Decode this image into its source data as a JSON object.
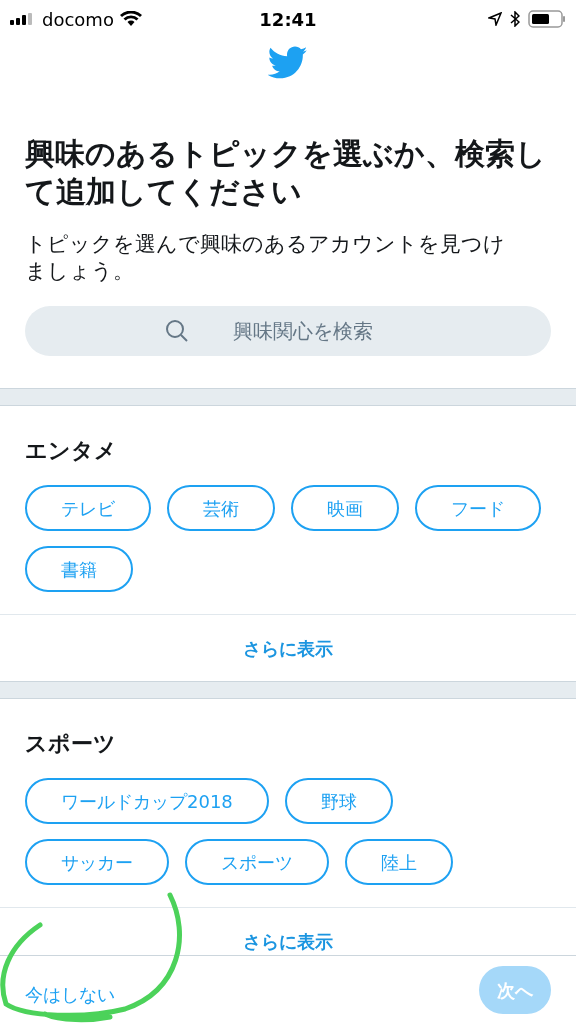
{
  "status_bar": {
    "carrier": "docomo",
    "time": "12:41"
  },
  "title": "興味のあるトピックを選ぶか、検索して追加してください",
  "subtitle": "トピックを選んで興味のあるアカウントを見つけましょう。",
  "search": {
    "placeholder": "興味関心を検索"
  },
  "sections": [
    {
      "heading": "エンタメ",
      "topics": [
        {
          "label": "テレビ",
          "selected": false
        },
        {
          "label": "芸術",
          "selected": false
        },
        {
          "label": "映画",
          "selected": false
        },
        {
          "label": "フード",
          "selected": false
        },
        {
          "label": "書籍",
          "selected": false
        }
      ],
      "more": "さらに表示"
    },
    {
      "heading": "スポーツ",
      "topics": [
        {
          "label": "ワールドカップ2018",
          "selected": false
        },
        {
          "label": "野球",
          "selected": false
        },
        {
          "label": "サッカー",
          "selected": false
        },
        {
          "label": "スポーツ",
          "selected": false
        },
        {
          "label": "陸上",
          "selected": false
        }
      ],
      "more": "さらに表示"
    }
  ],
  "footer": {
    "skip": "今はしない",
    "next": {
      "label": "次へ",
      "disabled": true
    }
  }
}
